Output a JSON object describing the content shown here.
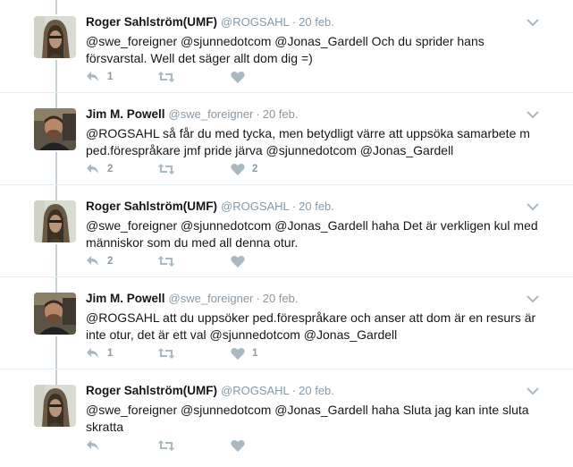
{
  "tweets": [
    {
      "name": "Roger Sahlström(UMF)",
      "handle": "@ROGSAHL",
      "date": "20 feb.",
      "text": "@swe_foreigner @sjunnedotcom @Jonas_Gardell Och du sprider hans försvarstal. Well det säger allt dom dig =)",
      "replies": "1",
      "retweets": "",
      "likes": "",
      "avatar": "roger"
    },
    {
      "name": "Jim M. Powell",
      "handle": "@swe_foreigner",
      "date": "20 feb.",
      "text": "@ROGSAHL så får du med tycka, men betydligt värre att uppsöka samarbete m ped.förespråkare jmf pride järva @sjunnedotcom @Jonas_Gardell",
      "replies": "2",
      "retweets": "",
      "likes": "2",
      "avatar": "jim"
    },
    {
      "name": "Roger Sahlström(UMF)",
      "handle": "@ROGSAHL",
      "date": "20 feb.",
      "text": "@swe_foreigner @sjunnedotcom @Jonas_Gardell haha Det är verkligen kul med människor som du med all denna otur.",
      "replies": "2",
      "retweets": "",
      "likes": "",
      "avatar": "roger"
    },
    {
      "name": "Jim M. Powell",
      "handle": "@swe_foreigner",
      "date": "20 feb.",
      "text": "@ROGSAHL att du uppsöker ped.förespråkare och anser att dom är en resurs är inte otur, det är ett val @sjunnedotcom @Jonas_Gardell",
      "replies": "1",
      "retweets": "",
      "likes": "1",
      "avatar": "jim"
    },
    {
      "name": "Roger Sahlström(UMF)",
      "handle": "@ROGSAHL",
      "date": "20 feb.",
      "text": "@swe_foreigner @sjunnedotcom @Jonas_Gardell haha Sluta jag kan inte sluta skratta",
      "replies": "",
      "retweets": "",
      "likes": "",
      "avatar": "roger"
    }
  ],
  "colors": {
    "name": "#14171a",
    "muted": "#8899a6",
    "icon": "#aab8c2",
    "thread_line": "#c4cfd6",
    "divider": "#e6ecf0"
  },
  "icons": {
    "reply": "reply-icon",
    "retweet": "retweet-icon",
    "like": "heart-icon",
    "more": "chevron-down-icon"
  }
}
